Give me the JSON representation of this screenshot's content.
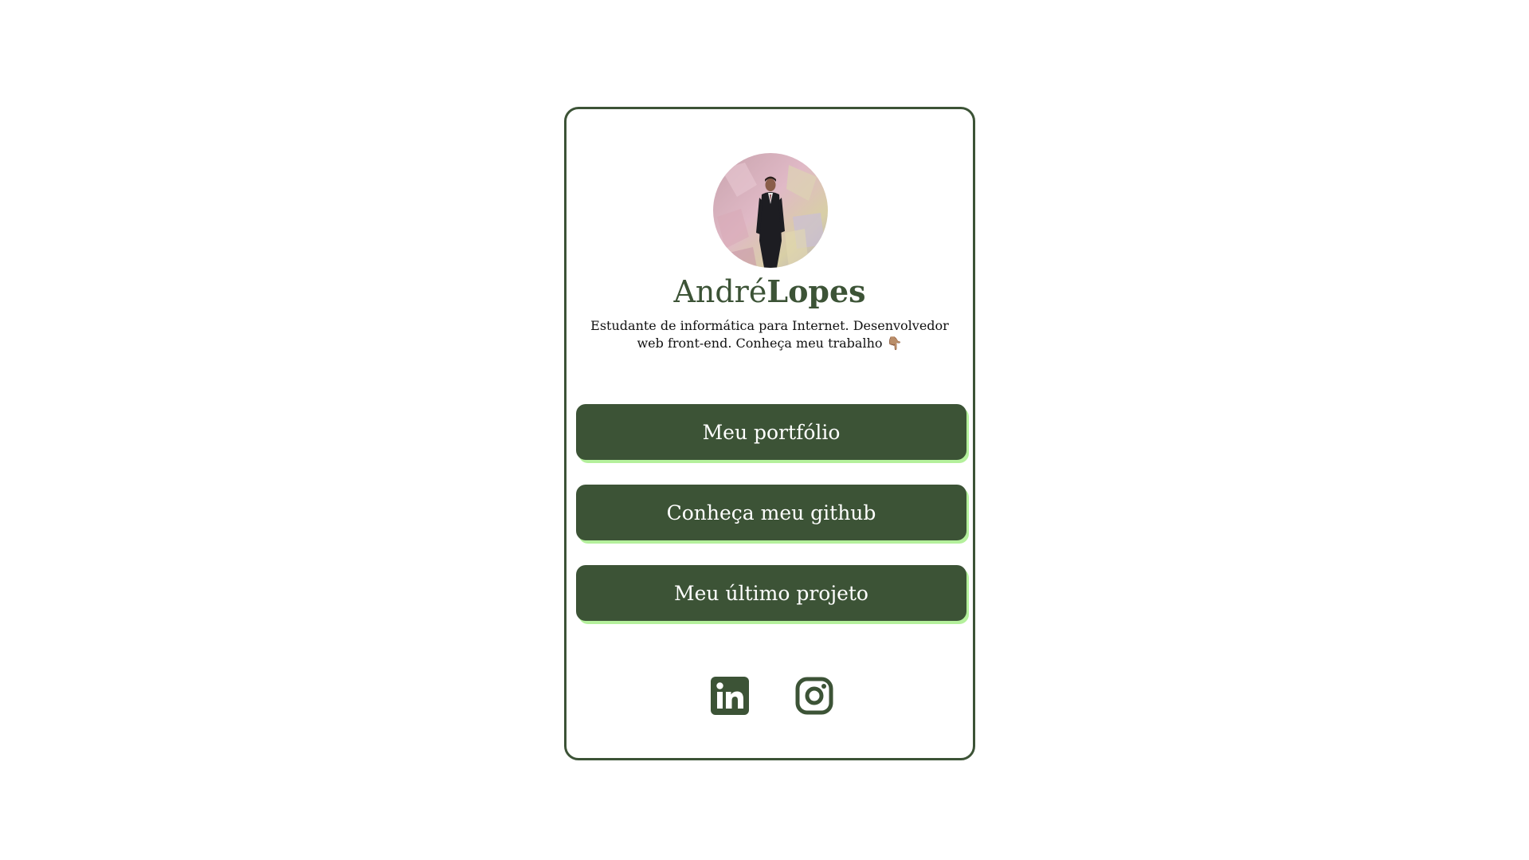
{
  "profile": {
    "first_name": "André",
    "last_name": "Lopes",
    "bio": "Estudante de informática para Internet. Desenvolvedor web front-end. Conheça meu trabalho",
    "bio_emoji": "👇🏽"
  },
  "links": [
    {
      "label": "Meu portfólio"
    },
    {
      "label": "Conheça meu github"
    },
    {
      "label": "Meu último projeto"
    }
  ],
  "socials": [
    {
      "icon": "linkedin-icon"
    },
    {
      "icon": "instagram-icon"
    }
  ],
  "colors": {
    "primary": "#3c5336",
    "button_shadow": "#b4f09c",
    "background": "#ffffff"
  }
}
